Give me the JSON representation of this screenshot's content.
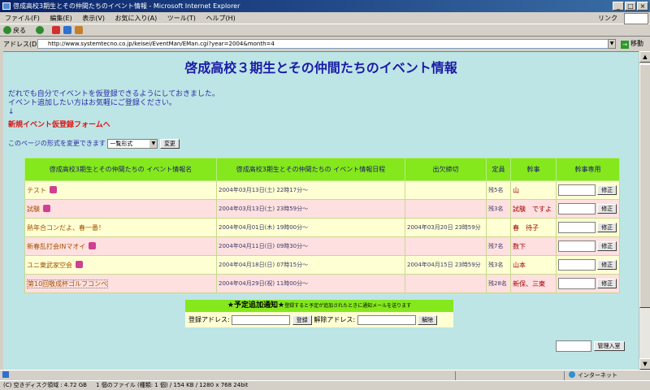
{
  "window": {
    "title": "啓成高校3期生とその仲間たちのイベント情報 - Microsoft Internet Explorer",
    "minimize": "_",
    "maximize": "□",
    "close": "×"
  },
  "menu": {
    "items": [
      "ファイル(F)",
      "編集(E)",
      "表示(V)",
      "お気に入り(A)",
      "ツール(T)",
      "ヘルプ(H)"
    ],
    "link_label": "リンク"
  },
  "toolbar": {
    "back_label": "戻る"
  },
  "address": {
    "label": "アドレス(D)",
    "url": "http://www.systemtecno.co.jp/keisei/EventMan/EMan.cgi?year=2004&month=4",
    "go_label": "移動"
  },
  "page": {
    "title": "啓成高校３期生とその仲間たちのイベント情報",
    "intro_line1": "だれでも自分でイベントを仮登録できるようにしておきました。",
    "intro_line2": "イベント追加したい方はお気軽にご登録ください。",
    "intro_arrow": "↓",
    "register_link": "新規イベント仮登録フォームへ",
    "format_label": "このページの形式を変更できます",
    "format_selected": "一覧形式",
    "format_button": "変更"
  },
  "table": {
    "headers": {
      "name": "啓成高校3期生とその仲間たちの イベント情報名",
      "date": "啓成高校3期生とその仲間たちの イベント情報日程",
      "deadline": "出欠締切",
      "capacity": "定員",
      "organizer": "幹事",
      "admin": "幹事専用"
    },
    "edit_label": "修正",
    "rows": [
      {
        "name": "テスト",
        "date": "2004年03月13日(土) 22時17分～",
        "deadline": "",
        "capacity": "残5名",
        "organizer": "山"
      },
      {
        "name": "試験",
        "date": "2004年03月13日(土) 23時59分～",
        "deadline": "",
        "capacity": "残3名",
        "organizer": "試験　ですよ"
      },
      {
        "name": "熱年合コンだよ、春一番！",
        "date": "2004年04月01日(木) 19時00分～",
        "deadline": "2004年03月20日 23時59分",
        "capacity": "",
        "organizer": "春　待子"
      },
      {
        "name": "新春乱打会INマオイ",
        "date": "2004年04月11日(日) 09時30分～",
        "deadline": "",
        "capacity": "残7名",
        "organizer": "数下"
      },
      {
        "name": "ユニ東武家空会",
        "date": "2004年04月18日(日) 07時15分～",
        "deadline": "2004年04月15日 23時59分",
        "capacity": "残3名",
        "organizer": "山本"
      },
      {
        "name": "第10回敬成杯ゴルフコンペ",
        "date": "2004年04月29日(祝) 11時00分～",
        "deadline": "",
        "capacity": "残28名",
        "organizer": "新保、三東"
      }
    ]
  },
  "notify": {
    "title": "★予定追加通知★",
    "subtitle": "登録すると予定が追加されたときに通知メールを送ります",
    "register_label": "登録アドレス:",
    "register_button": "登録",
    "unregister_label": "解除アドレス:",
    "unregister_button": "解除"
  },
  "admin": {
    "button": "管理入室"
  },
  "status": {
    "disk": "(C) 空きディスク領域 : 4.72 GB",
    "file": "1 個のファイル (種類: 1 個) / 154 KB / 1280 x 768 24bit",
    "zone": "インターネット"
  }
}
